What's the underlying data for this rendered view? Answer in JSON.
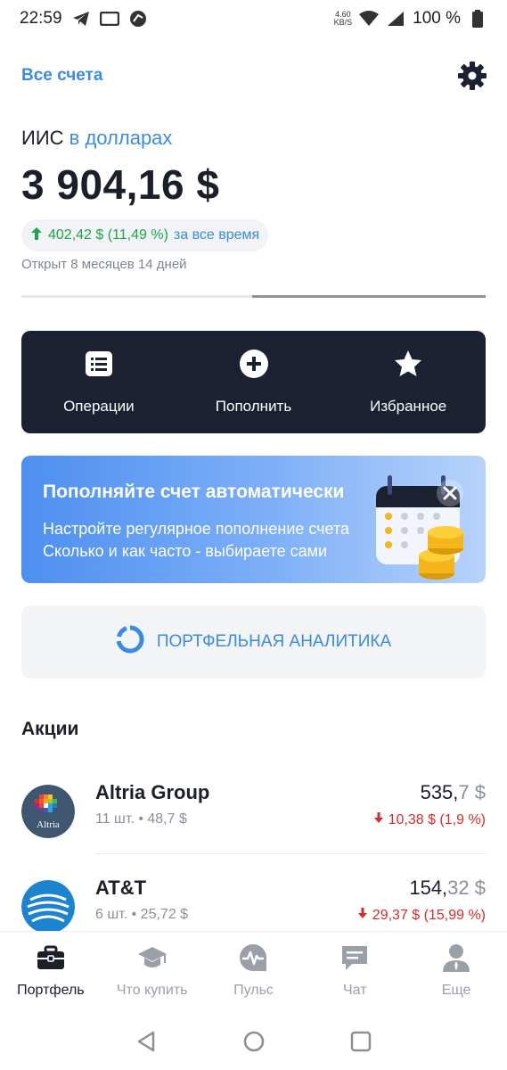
{
  "status_bar": {
    "time": "22:59",
    "net_speed_value": "4.60",
    "net_speed_unit": "KB/S",
    "battery": "100 %",
    "icons": [
      "telegram-icon",
      "cast-icon",
      "vpn-icon",
      "wifi-icon",
      "cell-signal-icon",
      "battery-icon"
    ]
  },
  "header": {
    "all_accounts": "Все счета",
    "settings_icon": "gear-icon"
  },
  "account": {
    "type": "ИИС",
    "currency_label": "в долларах",
    "balance": "3 904,16 $",
    "profit": "402,42 $ (11,49 %)",
    "profit_period": "за все время",
    "opened": "Открыт 8 месяцев 14 дней"
  },
  "actions": [
    {
      "label": "Операции",
      "icon": "list-icon"
    },
    {
      "label": "Пополнить",
      "icon": "plus-circle-icon"
    },
    {
      "label": "Избранное",
      "icon": "star-icon"
    }
  ],
  "promo": {
    "title": "Пополняйте счет автоматически",
    "line1": "Настройте регулярное пополнение счета",
    "line2": "Сколько и как часто - выбираете сами"
  },
  "analytics": {
    "label": "ПОРТФЕЛЬНАЯ АНАЛИТИКА"
  },
  "section": {
    "title": "Акции"
  },
  "stocks": [
    {
      "name": "Altria Group",
      "logo_text": "Altria",
      "meta": "11 шт. • 48,7 $",
      "price_int": "535,",
      "price_dec": "7 $",
      "change": "10,38 $ (1,9 %)"
    },
    {
      "name": "AT&T",
      "meta": "6 шт. • 25,72 $",
      "price_int": "154,",
      "price_dec": "32 $",
      "change": "29,37 $ (15,99 %)"
    }
  ],
  "bottom_nav": [
    {
      "label": "Портфель",
      "icon": "briefcase-icon",
      "active": true
    },
    {
      "label": "Что купить",
      "icon": "graduation-cap-icon",
      "active": false
    },
    {
      "label": "Пульс",
      "icon": "pulse-icon",
      "active": false
    },
    {
      "label": "Чат",
      "icon": "chat-icon",
      "active": false
    },
    {
      "label": "Еще",
      "icon": "user-icon",
      "active": false
    }
  ],
  "colors": {
    "accent": "#3a8be2",
    "dark_panel": "#1b2130",
    "positive": "#1fa64a",
    "negative": "#d92b2b"
  }
}
